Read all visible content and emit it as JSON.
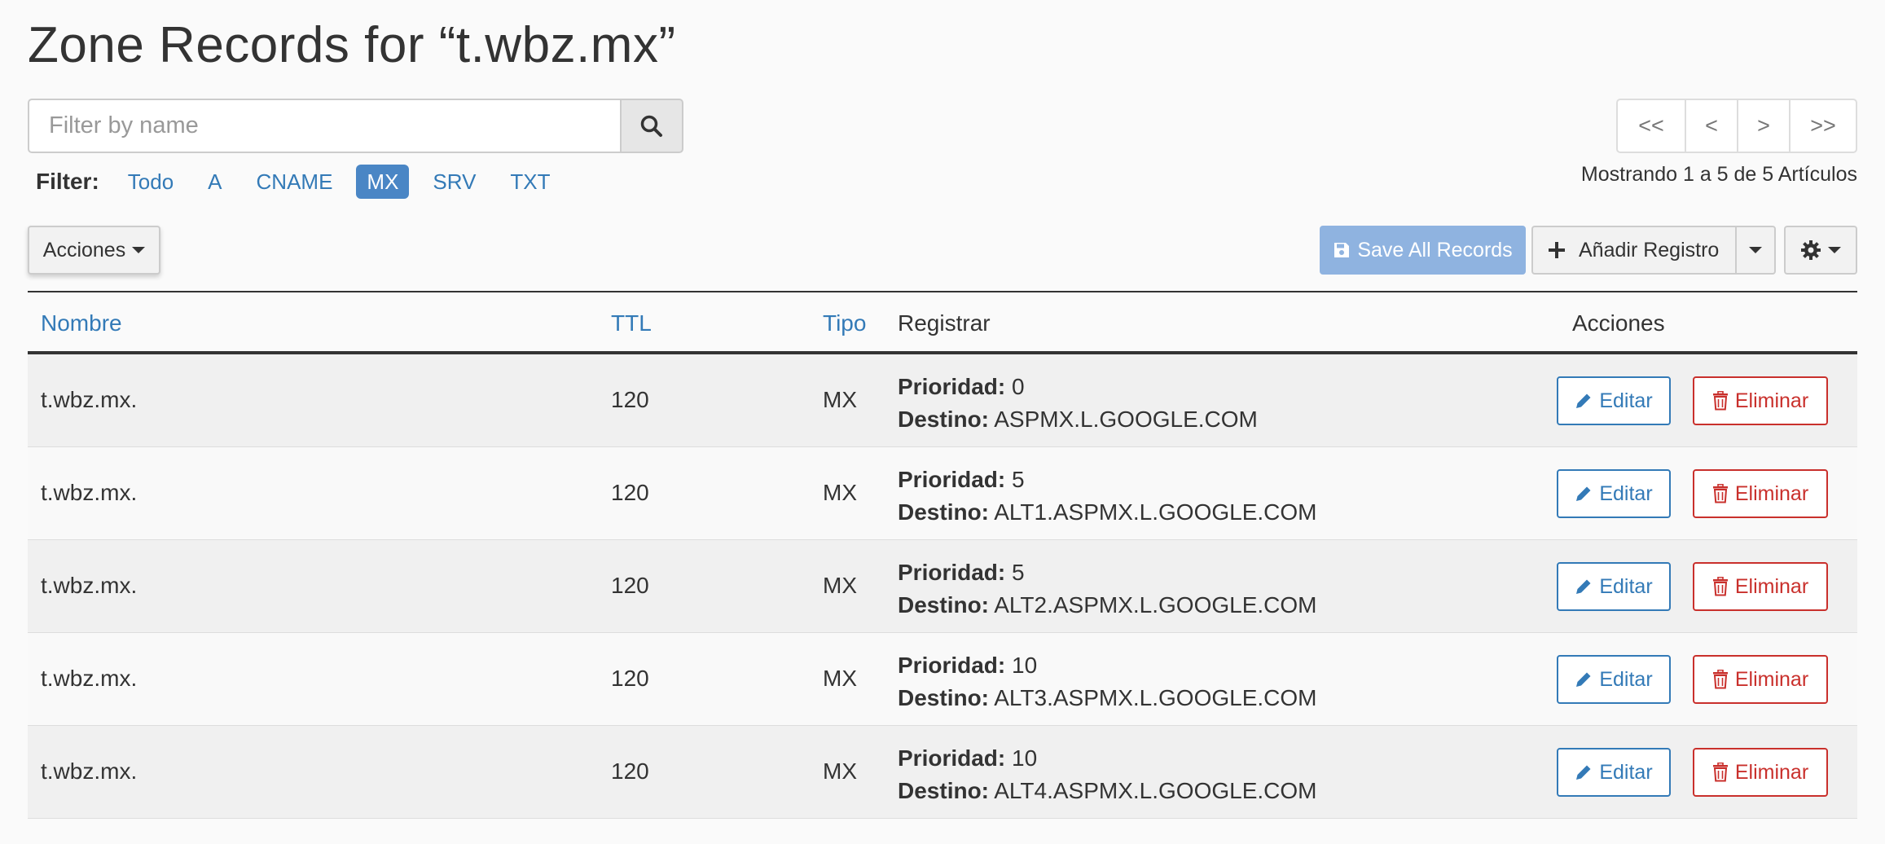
{
  "page": {
    "title": "Zone Records for “t.wbz.mx”"
  },
  "search": {
    "placeholder": "Filter by name"
  },
  "filter": {
    "label": "Filter:",
    "items": [
      "Todo",
      "A",
      "CNAME",
      "MX",
      "SRV",
      "TXT"
    ],
    "active": "MX"
  },
  "pager": {
    "first": "<<",
    "prev": "<",
    "next": ">",
    "last": ">>",
    "showing": "Mostrando 1 a 5 de 5 Artículos"
  },
  "toolbar": {
    "acciones_label": "Acciones",
    "save_label": "Save All Records",
    "add_label": "Añadir Registro"
  },
  "table": {
    "headers": {
      "name": "Nombre",
      "ttl": "TTL",
      "type": "Tipo",
      "record": "Registrar",
      "actions": "Acciones"
    },
    "priority_label": "Prioridad:",
    "dest_label": "Destino:",
    "edit_label": "Editar",
    "delete_label": "Eliminar",
    "rows": [
      {
        "name": "t.wbz.mx.",
        "ttl": "120",
        "type": "MX",
        "priority": "0",
        "dest": "ASPMX.L.GOOGLE.COM"
      },
      {
        "name": "t.wbz.mx.",
        "ttl": "120",
        "type": "MX",
        "priority": "5",
        "dest": "ALT1.ASPMX.L.GOOGLE.COM"
      },
      {
        "name": "t.wbz.mx.",
        "ttl": "120",
        "type": "MX",
        "priority": "5",
        "dest": "ALT2.ASPMX.L.GOOGLE.COM"
      },
      {
        "name": "t.wbz.mx.",
        "ttl": "120",
        "type": "MX",
        "priority": "10",
        "dest": "ALT3.ASPMX.L.GOOGLE.COM"
      },
      {
        "name": "t.wbz.mx.",
        "ttl": "120",
        "type": "MX",
        "priority": "10",
        "dest": "ALT4.ASPMX.L.GOOGLE.COM"
      }
    ]
  },
  "colors": {
    "link": "#337ab7",
    "active_filter": "#4a86c5",
    "save_button": "#8fb3e0",
    "danger": "#c9302c"
  },
  "icons": {
    "search": "search-icon",
    "save": "floppy-disk-icon",
    "add": "plus-icon",
    "gear": "gear-icon",
    "edit": "pencil-icon",
    "delete": "trash-icon"
  }
}
